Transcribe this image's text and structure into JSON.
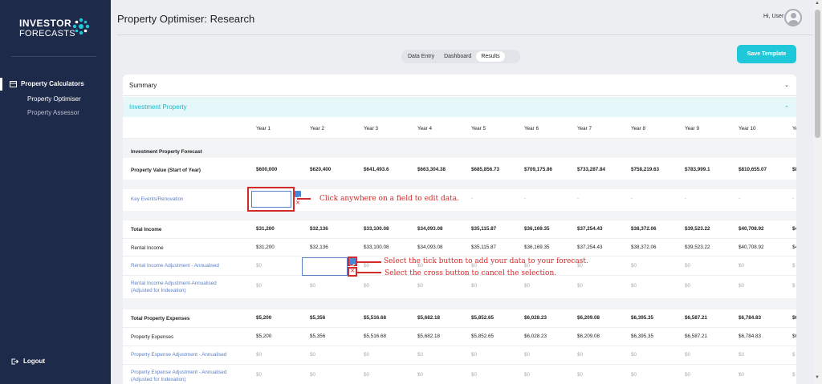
{
  "brand": {
    "line1": "INVESTOR",
    "line2": "FORECASTS"
  },
  "sidebar": {
    "section": "Property Calculators",
    "items": [
      "Property Optimiser",
      "Property Assessor"
    ],
    "logout": "Logout"
  },
  "header": {
    "title": "Property Optimiser: Research",
    "greeting": "Hi, User"
  },
  "tabs": [
    "Data Entry",
    "Dashboard",
    "Results"
  ],
  "active_tab": "Results",
  "save_button": "Save Template",
  "summary_label": "Summary",
  "section_label": "Investment Property",
  "years": [
    "Year 1",
    "Year 2",
    "Year 3",
    "Year 4",
    "Year 5",
    "Year 6",
    "Year 7",
    "Year 8",
    "Year 9",
    "Year 10",
    "Ye"
  ],
  "rows": {
    "forecast_heading": "Investment Property Forecast",
    "property_value": {
      "label": "Property Value (Start of Year)",
      "values": [
        "$600,000",
        "$620,400",
        "$641,493.6",
        "$663,304.38",
        "$685,856.73",
        "$709,175.86",
        "$733,287.84",
        "$758,219.63",
        "$783,999.1",
        "$810,655.07",
        "$8"
      ]
    },
    "key_events": {
      "label": "Key Events/Renovation",
      "values": [
        "",
        "",
        "-",
        "-",
        "-",
        "-",
        "-",
        "-",
        "-",
        "-",
        "-"
      ]
    },
    "total_income": {
      "label": "Total Income",
      "values": [
        "$31,200",
        "$32,136",
        "$33,100.08",
        "$34,093.08",
        "$35,115.87",
        "$36,169.35",
        "$37,254.43",
        "$38,372.06",
        "$39,523.22",
        "$40,708.92",
        "$4"
      ]
    },
    "rental_income": {
      "label": "Rental Income",
      "values": [
        "$31,200",
        "$32,136",
        "$33,100.08",
        "$34,093.08",
        "$35,115.87",
        "$36,169.35",
        "$37,254.43",
        "$38,372.06",
        "$39,523.22",
        "$40,708.92",
        "$4"
      ]
    },
    "rental_adj": {
      "label": "Rental Income Adjustment - Annualised",
      "values": [
        "$0",
        "",
        "$0",
        "$0",
        "$0",
        "$0",
        "$0",
        "$0",
        "$0",
        "$0",
        "$"
      ]
    },
    "rental_adj_idx": {
      "label1": "Rental Income Adjustment-Annualised",
      "label2": "(Adjusted for Indexation)",
      "values": [
        "$0",
        "$0",
        "$0",
        "$0",
        "$0",
        "$0",
        "$0",
        "$0",
        "$0",
        "$0",
        "$"
      ]
    },
    "total_expenses": {
      "label": "Total Property Expenses",
      "values": [
        "$5,200",
        "$5,356",
        "$5,516.68",
        "$5,682.18",
        "$5,852.65",
        "$6,028.23",
        "$6,209.08",
        "$6,395.35",
        "$6,587.21",
        "$6,784.83",
        "$6"
      ]
    },
    "property_expenses": {
      "label": "Property Expenses",
      "values": [
        "$5,200",
        "$5,356",
        "$5,516.68",
        "$5,682.18",
        "$5,852.65",
        "$6,028.23",
        "$6,209.08",
        "$6,395.35",
        "$6,587.21",
        "$6,784.83",
        "$6"
      ]
    },
    "expense_adj": {
      "label": "Property Expense Adjustment - Annualised",
      "values": [
        "$0",
        "$0",
        "$0",
        "$0",
        "$0",
        "$0",
        "$0",
        "$0",
        "$0",
        "$0",
        "$"
      ]
    },
    "expense_adj_idx": {
      "label1": "Property Expense Adjustment - Annualised",
      "label2": "(Adjusted for Indexation)",
      "values": [
        "$0",
        "$0",
        "$0",
        "$0",
        "$0",
        "$0",
        "$0",
        "$0",
        "$0",
        "$0",
        "$"
      ]
    }
  },
  "annotations": {
    "edit": "Click anywhere on a field to edit data.",
    "tick": "Select the tick button to add your data to your forecast.",
    "cross": "Select the cross button to cancel the selection."
  }
}
